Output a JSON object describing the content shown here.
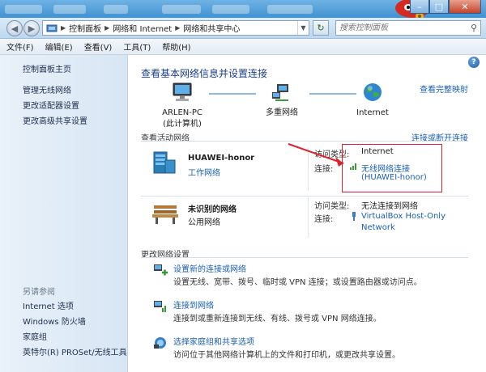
{
  "address": {
    "crumbs": [
      "控制面板",
      "网络和 Internet",
      "网络和共享中心"
    ],
    "search_placeholder": "搜索控制面板"
  },
  "menu": [
    "文件(F)",
    "编辑(E)",
    "查看(V)",
    "工具(T)",
    "帮助(H)"
  ],
  "sidebar": {
    "items": [
      "控制面板主页",
      "管理无线网络",
      "更改适配器设置",
      "更改高级共享设置"
    ],
    "see_also_title": "另请参阅",
    "see_also": [
      "Internet 选项",
      "Windows 防火墙",
      "家庭组",
      "英特尔(R) PROSet/无线工具"
    ]
  },
  "main": {
    "title": "查看基本网络信息并设置连接",
    "view_full_map": "查看完整映射",
    "map": {
      "computer_name": "ARLEN-PC",
      "computer_sub": "(此计算机)",
      "multi_network": "多重网络",
      "internet": "Internet"
    },
    "active_label": "查看活动网络",
    "connect_disconnect": "连接或断开连接",
    "networks": [
      {
        "name": "HUAWEI-honor",
        "type": "工作网络",
        "access_label": "访问类型:",
        "access_value": "Internet",
        "conn_label": "连接:",
        "conn_value_1": "无线网络连接",
        "conn_value_2": "(HUAWEI-honor)"
      },
      {
        "name": "未识别的网络",
        "type": "公用网络",
        "access_label": "访问类型:",
        "access_value": "无法连接到网络",
        "conn_label": "连接:",
        "conn_value_1": "VirtualBox Host-Only",
        "conn_value_2": "Network"
      }
    ],
    "change_label": "更改网络设置",
    "tasks": [
      {
        "title": "设置新的连接或网络",
        "desc": "设置无线、宽带、拨号、临时或 VPN 连接；或设置路由器或访问点。"
      },
      {
        "title": "连接到网络",
        "desc": "连接到或重新连接到无线、有线、拨号或 VPN 网络连接。"
      },
      {
        "title": "选择家庭组和共享选项",
        "desc": "访问位于其他网络计算机上的文件和打印机，或更改共享设置。"
      }
    ]
  },
  "colors": {
    "accent_link": "#1a5fb4",
    "highlight_box": "#e0202a",
    "title_blue": "#1b3d8f"
  }
}
